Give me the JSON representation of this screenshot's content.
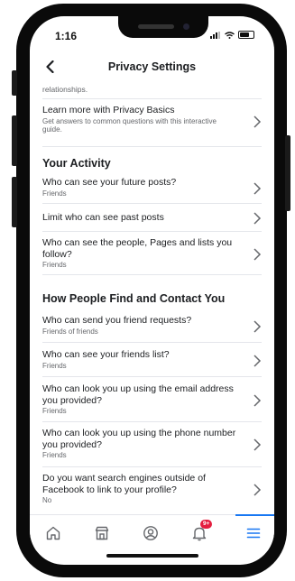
{
  "status": {
    "time": "1:16"
  },
  "nav": {
    "title": "Privacy Settings"
  },
  "partial_text": "relationships.",
  "learn_more": {
    "title": "Learn more with Privacy Basics",
    "subtitle": "Get answers to common questions with this interactive guide."
  },
  "your_activity": {
    "header": "Your Activity",
    "items": [
      {
        "title": "Who can see your future posts?",
        "subtitle": "Friends"
      },
      {
        "title": "Limit who can see past posts",
        "subtitle": ""
      },
      {
        "title": "Who can see the people, Pages and lists you follow?",
        "subtitle": "Friends"
      }
    ]
  },
  "find_contact": {
    "header": "How People Find and Contact You",
    "items": [
      {
        "title": "Who can send you friend requests?",
        "subtitle": "Friends of friends"
      },
      {
        "title": "Who can see your friends list?",
        "subtitle": "Friends"
      },
      {
        "title": "Who can look you up using the email address you provided?",
        "subtitle": "Friends"
      },
      {
        "title": "Who can look you up using the phone number you provided?",
        "subtitle": "Friends"
      },
      {
        "title": "Do you want search engines outside of Facebook to link to your profile?",
        "subtitle": "No"
      }
    ]
  },
  "tabbar": {
    "notification_badge": "9+",
    "accent_color": "#1877f2",
    "icons": [
      "home-icon",
      "marketplace-icon",
      "profile-icon",
      "notifications-icon",
      "menu-icon"
    ]
  }
}
